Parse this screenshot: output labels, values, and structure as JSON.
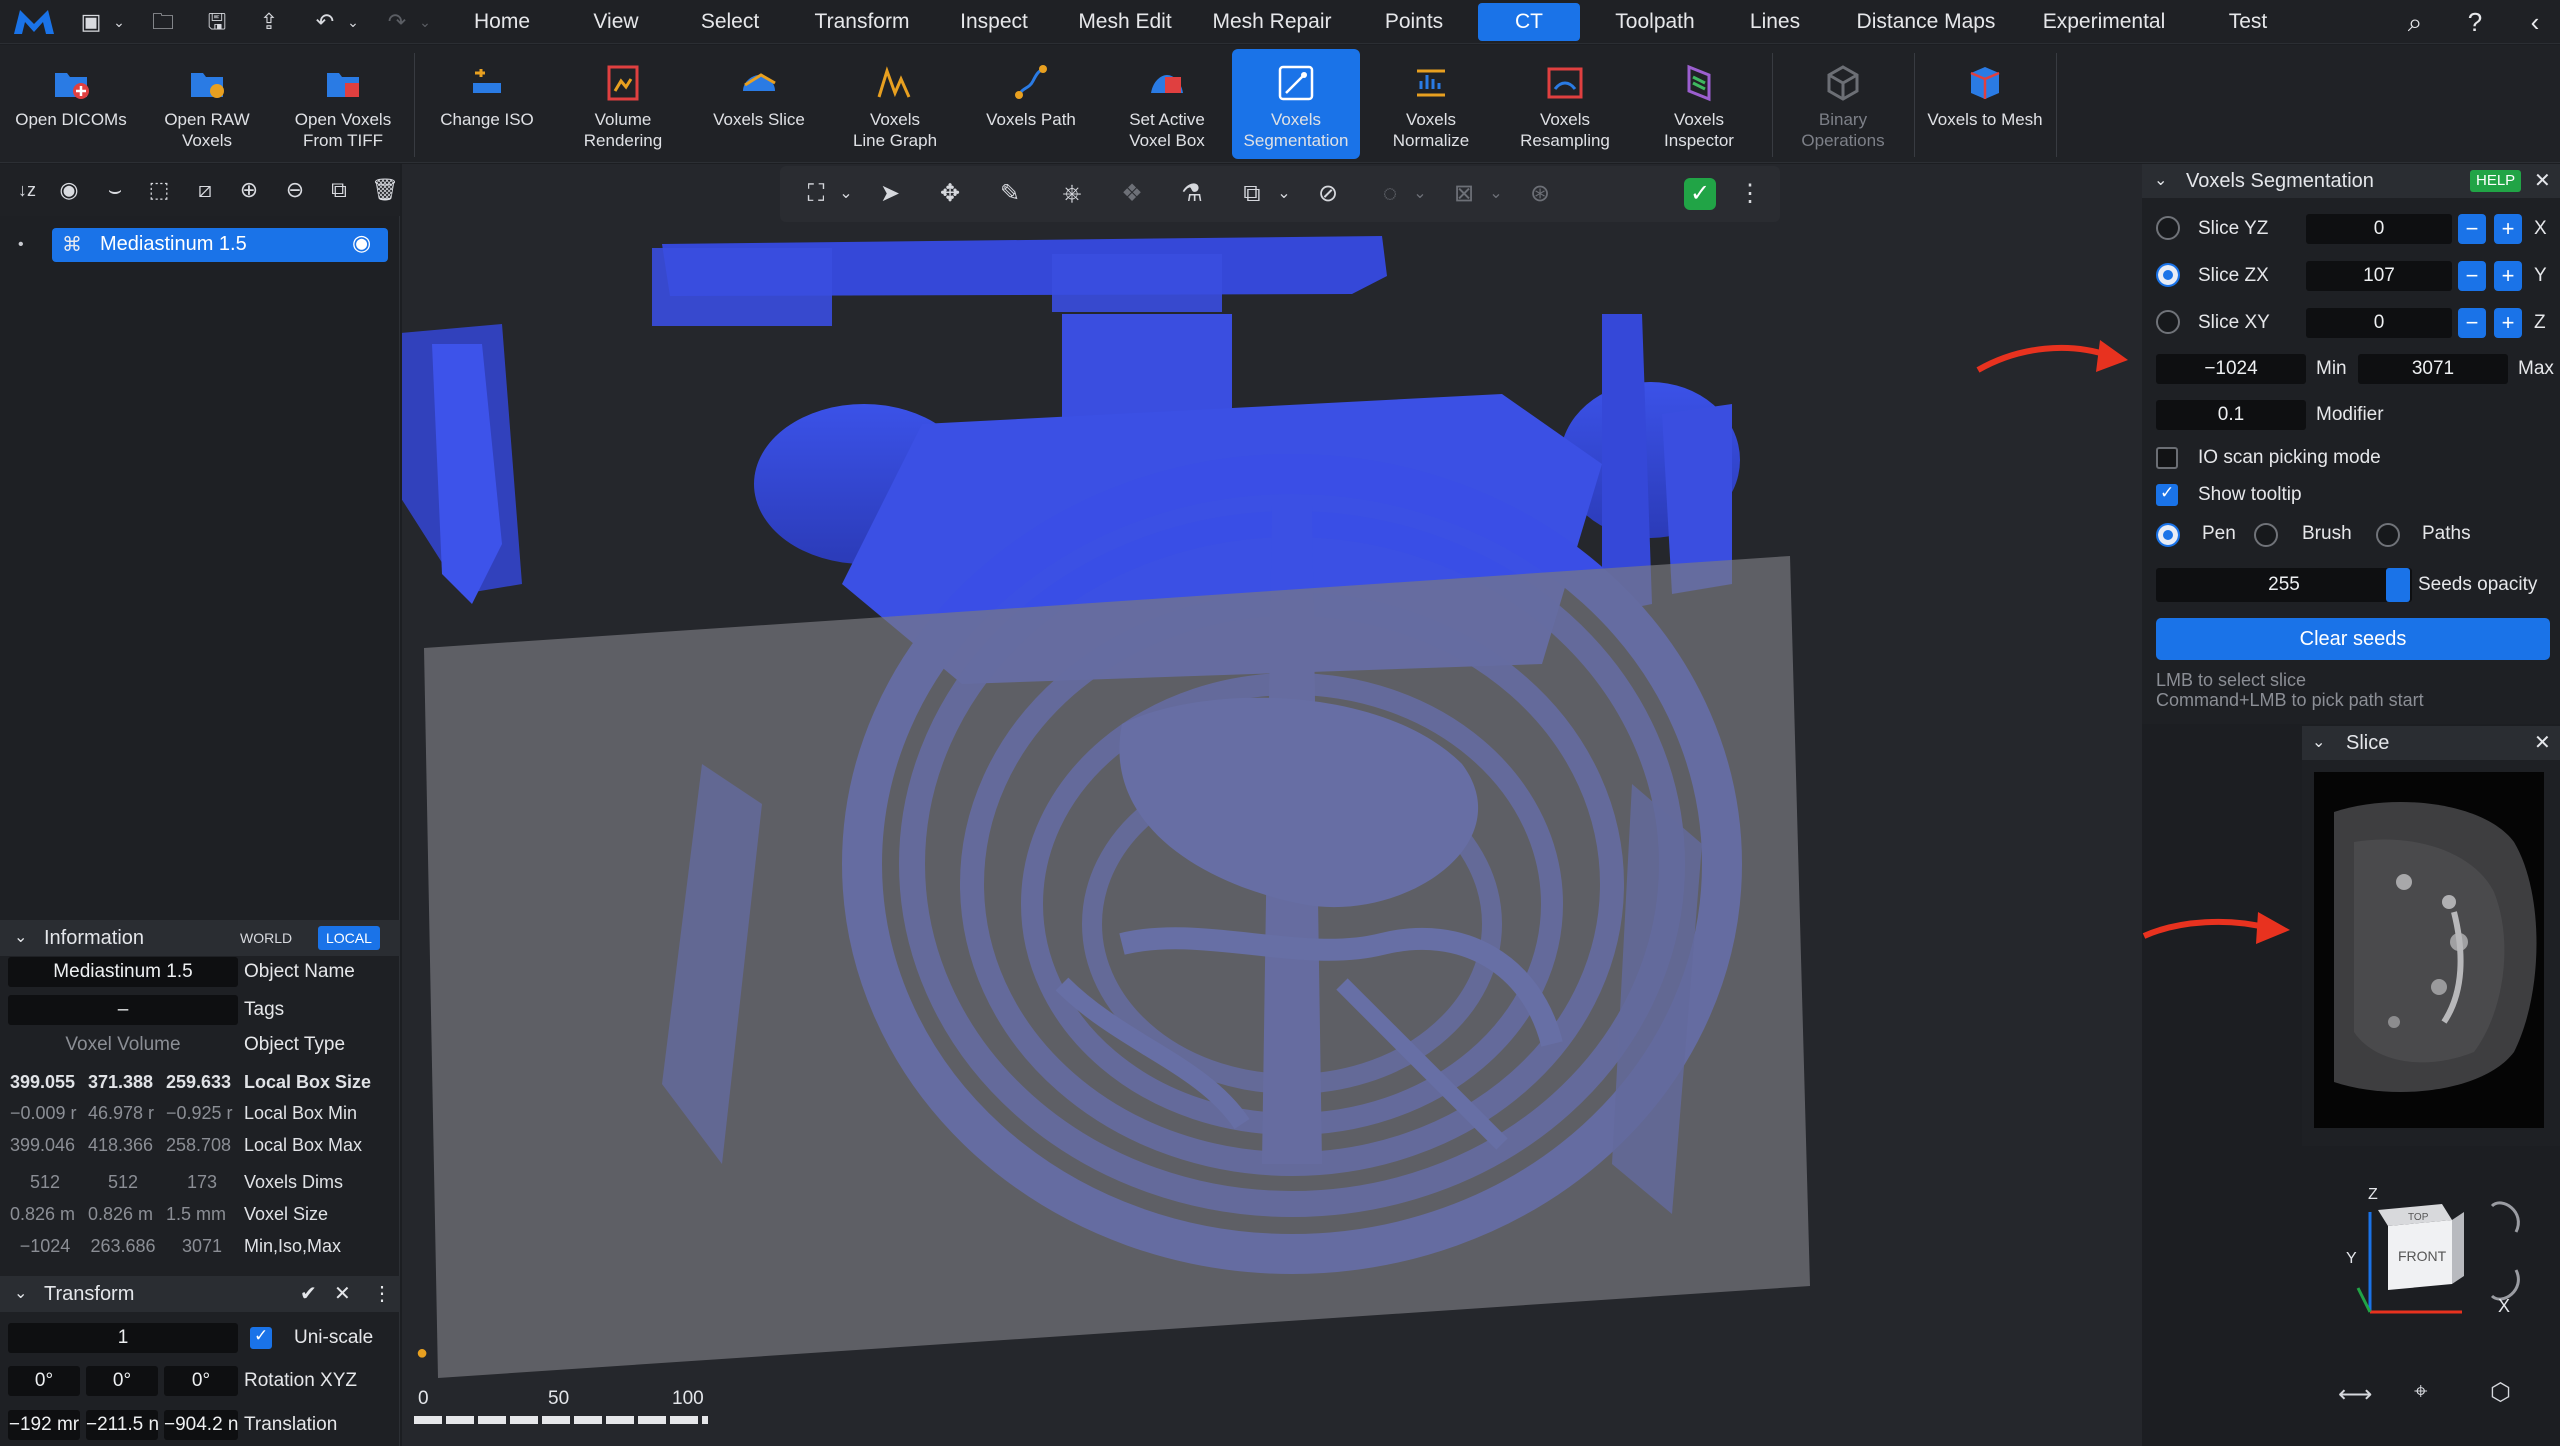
{
  "menubar": {
    "items": [
      "Home",
      "View",
      "Select",
      "Transform",
      "Inspect",
      "Mesh Edit",
      "Mesh Repair",
      "Points",
      "CT",
      "Toolpath",
      "Lines",
      "Distance Maps",
      "Experimental",
      "Test"
    ],
    "active": "CT"
  },
  "ribbon": {
    "tools": [
      {
        "label": "Open DICOMs",
        "icon": "open-dicoms-icon"
      },
      {
        "label": "Open RAW\nVoxels",
        "icon": "open-raw-voxels-icon"
      },
      {
        "label": "Open Voxels\nFrom TIFF",
        "icon": "open-tiff-icon"
      },
      {
        "label": "Change ISO",
        "icon": "change-iso-icon"
      },
      {
        "label": "Volume\nRendering",
        "icon": "volume-rendering-icon"
      },
      {
        "label": "Voxels Slice",
        "icon": "voxels-slice-icon"
      },
      {
        "label": "Voxels\nLine Graph",
        "icon": "line-graph-icon"
      },
      {
        "label": "Voxels Path",
        "icon": "voxels-path-icon"
      },
      {
        "label": "Set Active\nVoxel Box",
        "icon": "voxel-box-icon"
      },
      {
        "label": "Voxels\nSegmentation",
        "icon": "segmentation-icon"
      },
      {
        "label": "Voxels\nNormalize",
        "icon": "normalize-icon"
      },
      {
        "label": "Voxels\nResampling",
        "icon": "resampling-icon"
      },
      {
        "label": "Voxels\nInspector",
        "icon": "inspector-icon"
      },
      {
        "label": "Binary\nOperations",
        "icon": "binary-operations-icon"
      },
      {
        "label": "Voxels to Mesh",
        "icon": "voxels-to-mesh-icon"
      }
    ]
  },
  "tree": {
    "item_label": "Mediastinum 1.5"
  },
  "info": {
    "title": "Information",
    "world": "WORLD",
    "local": "LOCAL",
    "object_name_value": "Mediastinum 1.5",
    "object_name_label": "Object Name",
    "tags_value": "–",
    "tags_label": "Tags",
    "type_value": "Voxel Volume",
    "type_label": "Object Type",
    "rows": [
      {
        "v": [
          "399.055",
          "371.388",
          "259.633"
        ],
        "label": "Local Box Size",
        "bold": true
      },
      {
        "v": [
          "−0.009 r",
          "46.978 r",
          "−0.925 r"
        ],
        "label": "Local Box Min",
        "bold": false
      },
      {
        "v": [
          "399.046",
          "418.366",
          "258.708"
        ],
        "label": "Local Box Max",
        "bold": false
      },
      {
        "v": [
          "512",
          "512",
          "173"
        ],
        "label": "Voxels Dims",
        "bold": false
      },
      {
        "v": [
          "0.826 m",
          "0.826 m",
          "1.5 mm"
        ],
        "label": "Voxel Size",
        "bold": false
      },
      {
        "v": [
          "−1024",
          "263.686",
          "3071"
        ],
        "label": "Min,Iso,Max",
        "bold": false
      }
    ]
  },
  "transform": {
    "title": "Transform",
    "scale_value": "1",
    "uniscale_label": "Uni-scale",
    "rotation": [
      "0°",
      "0°",
      "0°"
    ],
    "rotation_label": "Rotation XYZ",
    "translation": [
      "−192 mr",
      "−211.5 n",
      "−904.2 n"
    ],
    "translation_label": "Translation"
  },
  "segmentation": {
    "title": "Voxels Segmentation",
    "help": "HELP",
    "slices": [
      {
        "label": "Slice YZ",
        "value": "0",
        "axis": "X",
        "selected": false
      },
      {
        "label": "Slice ZX",
        "value": "107",
        "axis": "Y",
        "selected": true
      },
      {
        "label": "Slice XY",
        "value": "0",
        "axis": "Z",
        "selected": false
      }
    ],
    "min_value": "−1024",
    "min_label": "Min",
    "max_value": "3071",
    "max_label": "Max",
    "modifier_value": "0.1",
    "modifier_label": "Modifier",
    "io_scan_label": "IO scan picking mode",
    "io_scan_checked": false,
    "tooltip_label": "Show tooltip",
    "tooltip_checked": true,
    "tools": [
      {
        "label": "Pen",
        "selected": true
      },
      {
        "label": "Brush",
        "selected": false
      },
      {
        "label": "Paths",
        "selected": false
      }
    ],
    "seeds_opacity_value": "255",
    "seeds_opacity_label": "Seeds opacity",
    "clear_label": "Clear seeds",
    "hint1": "LMB to select slice",
    "hint2": "Command+LMB to pick path start"
  },
  "slicepanel": {
    "title": "Slice"
  },
  "ruler": {
    "ticks": [
      "0",
      "50",
      "100"
    ]
  },
  "navcube": {
    "top": "TOP",
    "front": "FRONT",
    "x": "X",
    "y": "Y",
    "z": "Z"
  },
  "colors": {
    "accent": "#1a73e8",
    "voxel": "#3a4fe0",
    "slice_plane": "#6b6b70",
    "annotation_arrow": "#e8321f"
  }
}
